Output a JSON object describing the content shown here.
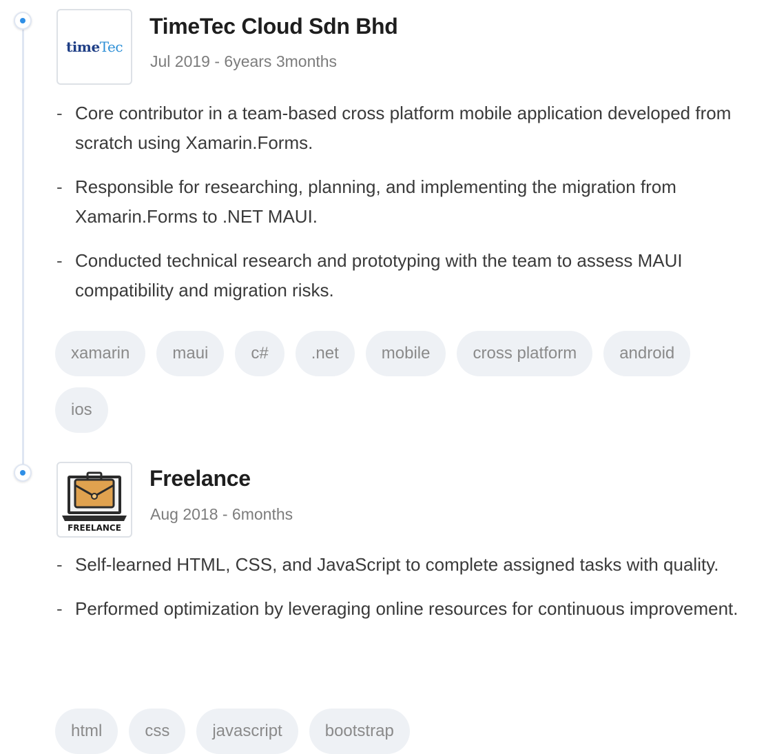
{
  "experience": [
    {
      "company": "TimeTec Cloud Sdn Bhd",
      "period": "Jul 2019 - 6years 3months",
      "logo": {
        "type": "timetec-logo",
        "text_primary": "time",
        "text_secondary": "Tec"
      },
      "bullets": [
        "Core contributor in a team-based cross platform mobile application developed from scratch using Xamarin.Forms.",
        "Responsible for researching, planning, and implementing the migration from Xamarin.Forms to .NET MAUI.",
        "Conducted technical research and prototyping with the team to assess MAUI compatibility and migration risks."
      ],
      "tags": [
        "xamarin",
        "maui",
        "c#",
        ".net",
        "mobile",
        "cross platform",
        "android",
        "ios"
      ]
    },
    {
      "company": "Freelance",
      "period": "Aug 2018 - 6months",
      "logo": {
        "type": "briefcase-laptop-icon",
        "text_primary": "FREELANCE"
      },
      "bullets": [
        "Self-learned HTML, CSS, and JavaScript to complete assigned tasks with quality.",
        "Performed optimization by leveraging online resources for continuous improvement."
      ],
      "tags": [
        "html",
        "css",
        "javascript",
        "bootstrap"
      ]
    }
  ],
  "colors": {
    "timeline_line": "#dfe6f2",
    "timeline_dot": "#2f8fe6",
    "tag_background": "#eef1f5",
    "tag_text": "#8a8a8a",
    "company_text": "#1e1e1e",
    "period_text": "#7c7c7c"
  }
}
